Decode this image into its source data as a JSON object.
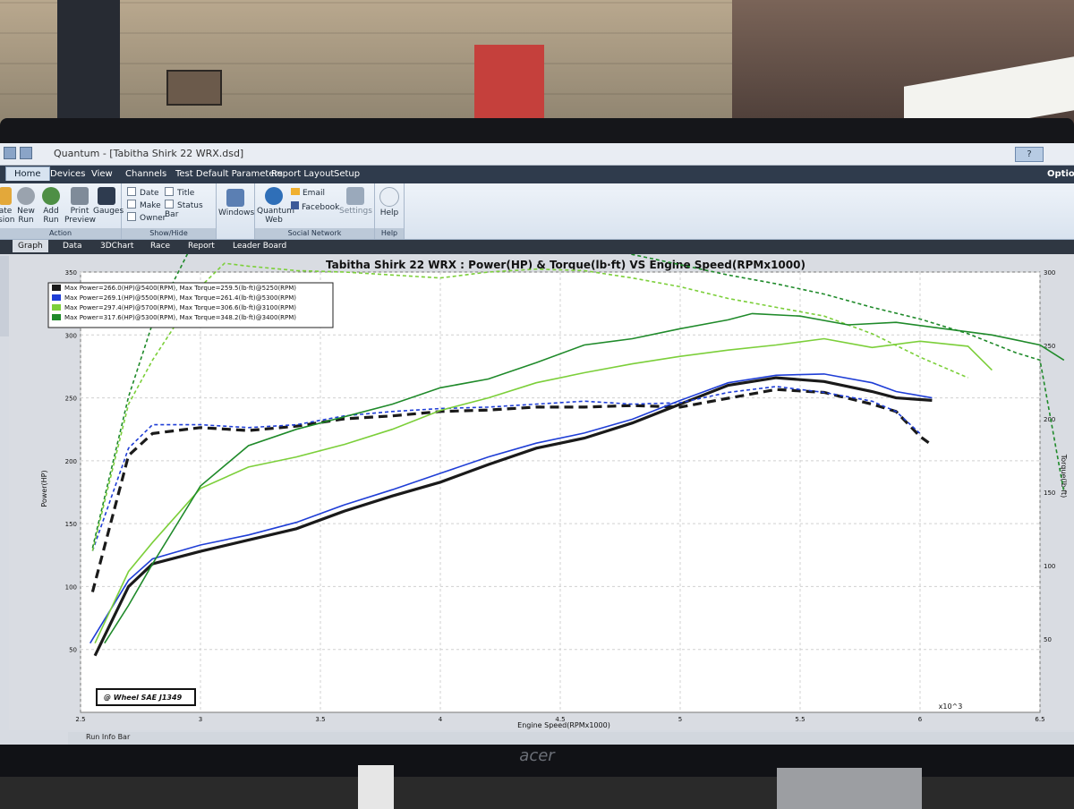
{
  "app": {
    "title": "Quantum - [Tabitha Shirk 22 WRX.dsd]",
    "help_button": "?",
    "options_label": "Options"
  },
  "menu": {
    "items": [
      "Home",
      "Devices",
      "View",
      "Channels",
      "Test Default Parameters",
      "Report Layout",
      "Setup"
    ]
  },
  "ribbon": {
    "action": {
      "label": "Action",
      "buttons": [
        {
          "label": "ate\nsion",
          "icon": "update-icon"
        },
        {
          "label": "New Run",
          "icon": "new-run-icon"
        },
        {
          "label": "Add Run",
          "icon": "add-run-icon"
        },
        {
          "label": "Print Preview",
          "icon": "print-icon"
        },
        {
          "label": "Gauges",
          "icon": "gauges-icon"
        }
      ]
    },
    "show_hide": {
      "label": "Show/Hide",
      "checks": [
        "Date",
        "Make",
        "Owner",
        "Title",
        "Status Bar"
      ]
    },
    "windows": {
      "label": "Windows"
    },
    "social": {
      "label": "Social Network",
      "buttons": [
        "Quantum Web",
        "Email",
        "Facebook",
        "Settings"
      ]
    },
    "help": {
      "label": "Help",
      "button": "Help"
    }
  },
  "tabs": [
    "Graph",
    "Data",
    "3DChart",
    "Race",
    "Report",
    "Leader Board"
  ],
  "status_bar": {
    "label": "Run Info Bar"
  },
  "chart_data": {
    "type": "line",
    "title": "Tabitha Shirk 22 WRX : Power(HP) & Torque(lb·ft) VS Engine Speed(RPMx1000)",
    "xlabel": "Engine Speed(RPMx1000)",
    "ylabel_left": "Power(HP)",
    "ylabel_right": "Torque(lb·ft)",
    "x_unit_label": "x10^3",
    "correction_label": "@ Wheel SAE J1349",
    "xlim": [
      2.5,
      6.5
    ],
    "ylim_left": [
      0,
      350
    ],
    "ylim_right": [
      0,
      300
    ],
    "x_ticks": [
      "2.5",
      "3",
      "3.5",
      "4",
      "4.5",
      "5",
      "5.5",
      "6",
      "6.5"
    ],
    "y_ticks_left": [
      "50",
      "100",
      "150",
      "200",
      "250",
      "300",
      "350"
    ],
    "y_ticks_right": [
      "50",
      "100",
      "150",
      "200",
      "250",
      "300"
    ],
    "grid": true,
    "legend_position": "top-left",
    "series": [
      {
        "name": "Max Power=266.0(HP)@5400(RPM), Max Torque=259.5(lb·ft)@5250(RPM)",
        "color": "#1a1a1a",
        "power": {
          "x": [
            2.56,
            2.7,
            2.8,
            3.0,
            3.2,
            3.4,
            3.6,
            3.8,
            4.0,
            4.2,
            4.4,
            4.6,
            4.8,
            5.0,
            5.2,
            5.4,
            5.6,
            5.8,
            5.9,
            6.05
          ],
          "y": [
            45,
            100,
            118,
            128,
            137,
            146,
            160,
            172,
            183,
            197,
            210,
            218,
            230,
            245,
            260,
            266,
            263,
            255,
            250,
            248
          ]
        },
        "torque": {
          "x": [
            2.55,
            2.7,
            2.8,
            3.0,
            3.2,
            3.4,
            3.6,
            3.8,
            4.0,
            4.2,
            4.4,
            4.6,
            4.8,
            5.0,
            5.2,
            5.4,
            5.6,
            5.8,
            5.9,
            6.0,
            6.05
          ],
          "y": [
            82,
            175,
            190,
            194,
            192,
            195,
            200,
            202,
            205,
            206,
            208,
            208,
            209,
            208,
            214,
            220,
            218,
            210,
            205,
            188,
            182
          ]
        }
      },
      {
        "name": "Max Power=269.1(HP)@5500(RPM), Max Torque=261.4(lb·ft)@5300(RPM)",
        "color": "#1f3ed6",
        "power": {
          "x": [
            2.54,
            2.7,
            2.8,
            3.0,
            3.2,
            3.4,
            3.6,
            3.8,
            4.0,
            4.2,
            4.4,
            4.6,
            4.8,
            5.0,
            5.2,
            5.4,
            5.6,
            5.8,
            5.9,
            6.05
          ],
          "y": [
            55,
            105,
            122,
            133,
            141,
            151,
            165,
            177,
            190,
            203,
            214,
            222,
            233,
            248,
            262,
            268,
            269,
            262,
            255,
            250
          ]
        },
        "torque": {
          "x": [
            2.55,
            2.7,
            2.8,
            3.0,
            3.2,
            3.4,
            3.6,
            3.8,
            4.0,
            4.2,
            4.4,
            4.6,
            4.8,
            5.0,
            5.2,
            5.4,
            5.6,
            5.8,
            5.9,
            6.0
          ],
          "y": [
            110,
            180,
            196,
            196,
            194,
            196,
            202,
            205,
            207,
            208,
            210,
            212,
            210,
            211,
            218,
            222,
            218,
            212,
            205,
            190
          ]
        }
      },
      {
        "name": "Max Power=297.4(HP)@5700(RPM), Max Torque=306.6(lb·ft)@3100(RPM)",
        "color": "#7ccf3a",
        "power": {
          "x": [
            2.56,
            2.7,
            2.8,
            3.0,
            3.2,
            3.4,
            3.6,
            3.8,
            4.0,
            4.2,
            4.4,
            4.6,
            4.8,
            5.0,
            5.2,
            5.4,
            5.6,
            5.8,
            6.0,
            6.2,
            6.3
          ],
          "y": [
            55,
            112,
            135,
            178,
            195,
            203,
            213,
            225,
            240,
            250,
            262,
            270,
            277,
            283,
            288,
            292,
            297,
            290,
            295,
            291,
            272
          ]
        },
        "torque": {
          "x": [
            2.55,
            2.7,
            2.8,
            3.0,
            3.1,
            3.2,
            3.4,
            3.6,
            3.8,
            4.0,
            4.2,
            4.4,
            4.6,
            4.8,
            5.0,
            5.2,
            5.4,
            5.6,
            5.8,
            6.0,
            6.2
          ],
          "y": [
            110,
            210,
            240,
            290,
            306,
            304,
            301,
            300,
            298,
            296,
            300,
            302,
            301,
            296,
            290,
            282,
            276,
            270,
            258,
            242,
            228
          ]
        }
      },
      {
        "name": "Max Power=317.6(HP)@5300(RPM), Max Torque=348.2(lb·ft)@3400(RPM)",
        "color": "#1f8a2a",
        "power": {
          "x": [
            2.6,
            2.7,
            2.8,
            3.0,
            3.2,
            3.4,
            3.6,
            3.8,
            4.0,
            4.2,
            4.4,
            4.6,
            4.8,
            5.0,
            5.2,
            5.3,
            5.5,
            5.7,
            5.9,
            6.1,
            6.3,
            6.5,
            6.6
          ],
          "y": [
            55,
            85,
            118,
            180,
            212,
            225,
            235,
            245,
            258,
            265,
            278,
            292,
            297,
            305,
            312,
            317,
            315,
            308,
            310,
            305,
            300,
            292,
            280
          ]
        },
        "torque": {
          "x": [
            2.55,
            2.7,
            2.8,
            3.0,
            3.2,
            3.4,
            3.6,
            3.8,
            4.0,
            4.2,
            4.4,
            4.6,
            4.8,
            5.0,
            5.2,
            5.4,
            5.6,
            5.8,
            6.0,
            6.2,
            6.4,
            6.5,
            6.6
          ],
          "y": [
            112,
            215,
            265,
            330,
            346,
            348,
            346,
            344,
            340,
            342,
            330,
            320,
            312,
            305,
            298,
            292,
            285,
            276,
            268,
            258,
            245,
            240,
            150
          ]
        }
      }
    ]
  }
}
